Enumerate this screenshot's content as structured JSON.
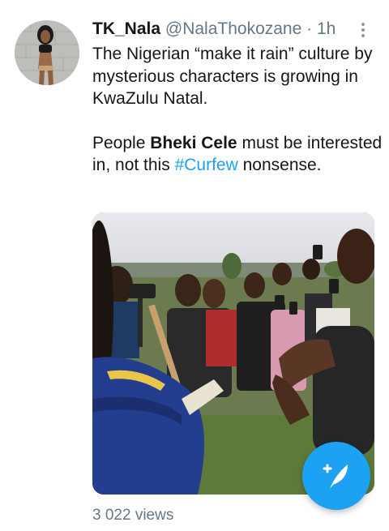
{
  "tweet": {
    "author_name": "TK_Nala",
    "handle": "@NalaThokozane",
    "separator": "·",
    "time": "1h",
    "text_line_1": "The Nigerian “make it rain” culture by mysterious characters is growing in KwaZulu Natal.",
    "text_2_prefix": "People ",
    "text_2_bold": "Bheki Cele",
    "text_2_middle": " must be interested in, not this ",
    "text_2_hashtag": "#Curfew",
    "text_2_suffix": " nonsense.",
    "views": "3 022 views"
  },
  "icons": {
    "menu": "more-vertical-icon",
    "compose": "compose-tweet-icon"
  },
  "colors": {
    "link": "#1da1f2",
    "fab": "#1da1f2",
    "muted": "#657786",
    "text": "#14171a"
  }
}
